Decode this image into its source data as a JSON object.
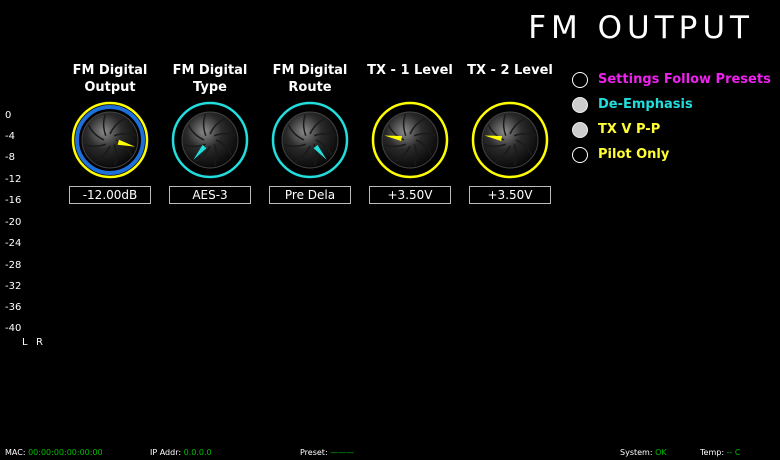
{
  "header": {
    "title": "FM OUTPUT"
  },
  "meter": {
    "ticks": [
      "0",
      "-4",
      "-8",
      "-12",
      "-16",
      "-20",
      "-24",
      "-28",
      "-32",
      "-36",
      "-40"
    ],
    "left_label": "L",
    "right_label": "R"
  },
  "knobs": [
    {
      "label": "FM Digital Output",
      "value": "-12.00dB",
      "ring_color": "#ffff00",
      "inner_ring_color": "#1e6fd9",
      "pointer_color": "#ffff00"
    },
    {
      "label": "FM Digital Type",
      "value": "AES-3",
      "ring_color": "#22dddd",
      "pointer_color": "#22dddd"
    },
    {
      "label": "FM Digital Route",
      "value": "Pre Dela",
      "ring_color": "#22dddd",
      "pointer_color": "#22dddd"
    },
    {
      "label": "TX - 1 Level",
      "value": "+3.50V",
      "ring_color": "#ffff00",
      "pointer_color": "#ffff00"
    },
    {
      "label": "TX - 2 Level",
      "value": "+3.50V",
      "ring_color": "#ffff00",
      "pointer_color": "#ffff00"
    }
  ],
  "options": [
    {
      "label": "Settings Follow Presets",
      "color": "#ee22ee",
      "checked": false
    },
    {
      "label": "De-Emphasis",
      "color": "#22dddd",
      "checked": true
    },
    {
      "label": "TX V P-P",
      "color": "#ffff33",
      "checked": true
    },
    {
      "label": "Pilot Only",
      "color": "#ffff33",
      "checked": false
    }
  ],
  "status": {
    "mac_label": "MAC:",
    "mac_value": "00:00:00:00:00:00",
    "ip_label": "IP Addr:",
    "ip_value": "0.0.0.0",
    "preset_label": "Preset:",
    "preset_value": "———",
    "system_label": "System:",
    "system_value": "OK",
    "temp_label": "Temp:",
    "temp_value": "-- C"
  }
}
